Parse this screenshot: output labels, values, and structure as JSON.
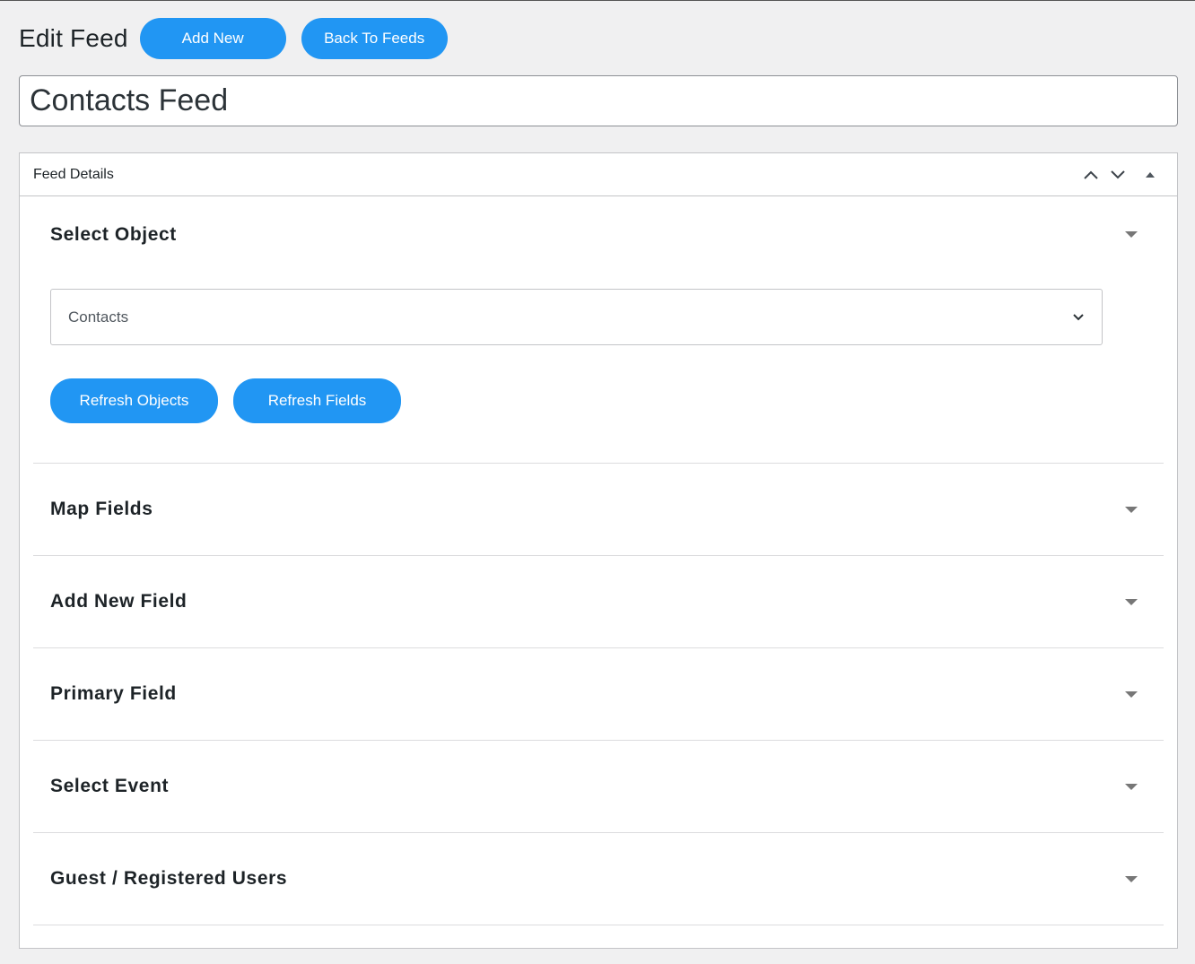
{
  "header": {
    "title": "Edit Feed",
    "add_new_label": "Add New",
    "back_label": "Back To Feeds"
  },
  "feed_title_value": "Contacts Feed",
  "postbox": {
    "title": "Feed Details",
    "controls": [
      "chevron-up-icon",
      "chevron-down-icon",
      "triangle-up-icon"
    ]
  },
  "select_object": {
    "title": "Select Object",
    "selected_value": "Contacts",
    "refresh_objects_label": "Refresh Objects",
    "refresh_fields_label": "Refresh Fields"
  },
  "sections": [
    {
      "title": "Map Fields"
    },
    {
      "title": "Add New Field"
    },
    {
      "title": "Primary Field"
    },
    {
      "title": "Select Event"
    },
    {
      "title": "Guest / Registered Users"
    }
  ],
  "colors": {
    "accent": "#2196f3",
    "page_bg": "#f0f0f1"
  }
}
